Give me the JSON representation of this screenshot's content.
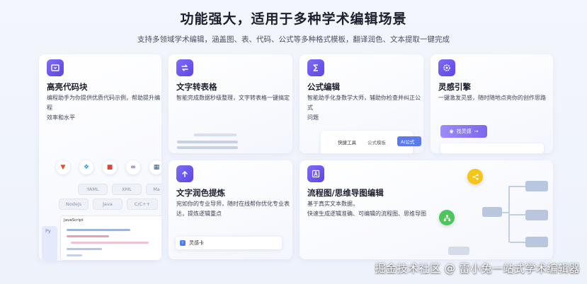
{
  "header": {
    "title": "功能强大，适用于多种学术编辑场景",
    "subtitle": "支持多领域学术编辑，涵盖图、表、代码、公式等多种格式模板，翻译润色、文本提取一键完成"
  },
  "cards": {
    "code": {
      "title": "高亮代码块",
      "desc_line1": "编程助手为你提供优质代码示例，帮助提升编程",
      "desc_line2": "效率和水平",
      "pills": [
        "YAML",
        "XML",
        "Ma",
        "Nodejs",
        "Java",
        "C/C++"
      ],
      "side_label": "Py",
      "panel_label": "JavaScript",
      "icon": "code-block-icon"
    },
    "table": {
      "title": "文字转表格",
      "desc": "智能完成数据秒级整理，文字转表格一键搞定",
      "icon": "convert-icon"
    },
    "formula": {
      "title": "公式编辑",
      "desc_line1": "智能助手化身数学大师，辅助你检查并纠正公式",
      "desc_line2": "问题",
      "tools": [
        "快捷工具",
        "公式模板",
        "AI公式"
      ],
      "icon": "sigma-icon"
    },
    "inspiration": {
      "title": "灵感引擎",
      "desc": "一键激发灵感，随时随地点亮你的创作思路",
      "button": "找灵感",
      "icon": "gear-icon"
    },
    "polish": {
      "title": "文字润色提炼",
      "desc_line1": "宛如你的专业导师，随时在线帮你优化专业表",
      "desc_line2": "达，提炼逻辑重点",
      "panel_label": "灵感卡",
      "icon": "upload-arrow-icon"
    },
    "flowchart": {
      "title": "流程图/思维导图编辑",
      "desc_line1": "基于真实文本数据，",
      "desc_line2": "快速生成逻辑准确、可编辑的流程图、思维导图",
      "icon": "letter-a-icon"
    }
  },
  "watermark": "掘金技术社区 @ 雷小兔一站式学术编辑器",
  "colors": {
    "accent": "#6a55ec",
    "background": "#eef2fb",
    "card": "#ffffff",
    "float_yellow": "#f5c518",
    "float_green": "#4cc65b"
  }
}
